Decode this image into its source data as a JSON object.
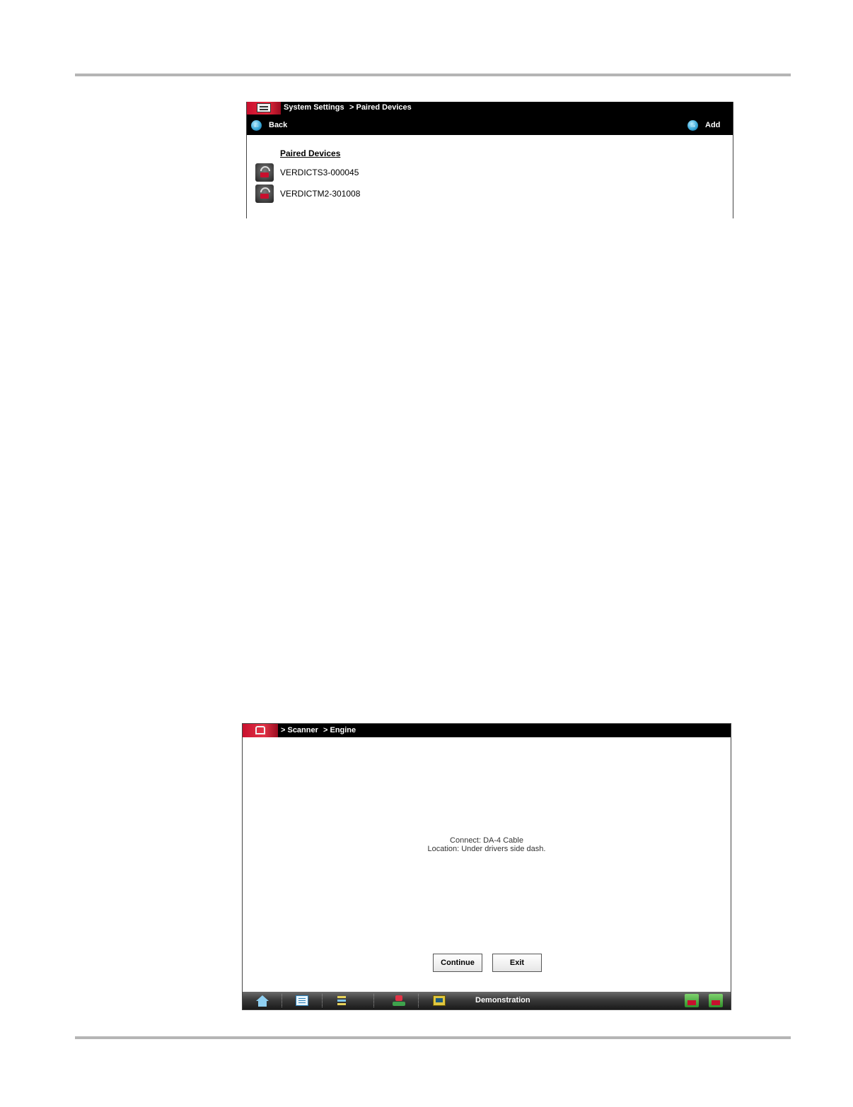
{
  "screen1": {
    "breadcrumb": [
      "System Settings",
      "> Paired Devices"
    ],
    "toolbar": {
      "back_label": "Back",
      "add_label": "Add"
    },
    "list_title": "Paired Devices",
    "devices": [
      {
        "label": "VERDICTS3-000045",
        "icon": "scanner-device-icon"
      },
      {
        "label": "VERDICTM2-301008",
        "icon": "scanner-device-icon"
      }
    ]
  },
  "screen2": {
    "breadcrumb": [
      "> Scanner",
      "> Engine"
    ],
    "message": {
      "line1": "Connect: DA-4 Cable",
      "line2": "Location: Under drivers side dash."
    },
    "buttons": {
      "continue_label": "Continue",
      "exit_label": "Exit"
    },
    "toolbar": {
      "label": "Demonstration",
      "icons": [
        "home-icon",
        "data-list-icon",
        "parameter-list-icon",
        "tools-icon",
        "scope-icon",
        "connection-status-icon",
        "vehicle-status-icon"
      ]
    }
  },
  "colors": {
    "header_bg": "#000000",
    "brand_red": "#c8102e",
    "accent_blue": "#3aa8d8"
  }
}
